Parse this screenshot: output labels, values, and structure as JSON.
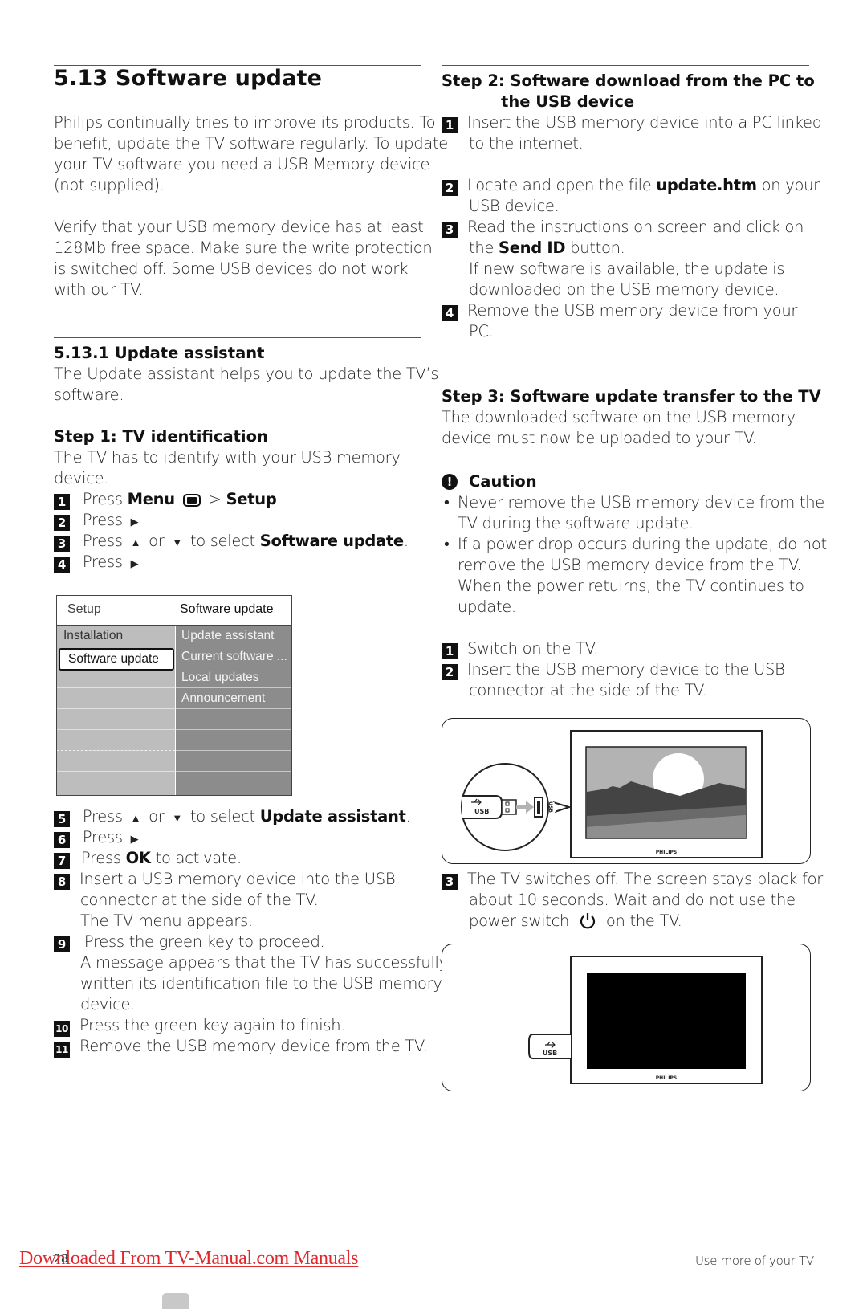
{
  "section": {
    "title": "5.13  Software update",
    "intro": [
      "Philips continually tries to improve its products. To",
      "benefit, update the TV software regularly. To update",
      "your TV software you need a USB Memory device",
      "(not supplied)."
    ],
    "verify": [
      "Verify that your USB memory device has at least",
      "128Mb free space. Make sure the write protection",
      "is switched off. Some USB devices do not work",
      "with our TV."
    ]
  },
  "subsection": {
    "title": "5.13.1  Update assistant",
    "intro": [
      "The Update assistant helps you to update the TV’s",
      "software."
    ]
  },
  "step1": {
    "title": "Step 1: TV identification",
    "intro": [
      "The TV has to identify with your USB memory",
      "device."
    ],
    "items": [
      {
        "num": "1",
        "pre": "Press ",
        "b1": "Menu",
        "mid": " > ",
        "b2": "Setup",
        "post": "."
      },
      {
        "num": "2",
        "pre": "Press ",
        "post": "."
      },
      {
        "num": "3",
        "pre": "Press ",
        "or": " or ",
        "mid": " to select ",
        "b1": "Software update",
        "post": "."
      },
      {
        "num": "4",
        "pre": "Press ",
        "post": "."
      },
      {
        "num": "5",
        "pre": "Press ",
        "or": " or ",
        "mid": " to select ",
        "b1": "Update assistant",
        "post": "."
      },
      {
        "num": "6",
        "pre": "Press ",
        "post": "."
      },
      {
        "num": "7",
        "pre": "Press ",
        "b1": "OK",
        "post": " to activate."
      },
      {
        "num": "8",
        "lines": [
          "Insert a USB memory device into the USB",
          "connector at the side of the TV.",
          "The TV menu appears."
        ]
      },
      {
        "num": "9",
        "lines": [
          " Press the green key to proceed.",
          "A message appears that the TV has successfully",
          "written its identification file to the USB memory",
          "device."
        ]
      },
      {
        "num": "10",
        "lines": [
          "Press the green key again to finish."
        ]
      },
      {
        "num": "11",
        "lines": [
          "Remove the USB memory device from the TV."
        ]
      }
    ],
    "glyphs": {
      "right": "▶",
      "up": "▲",
      "down": "▼"
    }
  },
  "tv_menu": {
    "header_left": "Setup",
    "header_right": "Software update",
    "left_items": [
      "Installation",
      "Software update"
    ],
    "selected": "Software update",
    "right_items": [
      "Update assistant",
      "Current software ...",
      "Local updates",
      "Announcement"
    ]
  },
  "step2": {
    "title_line1": "Step 2: Software download from the PC to",
    "title_line2": "the USB device",
    "items": [
      {
        "num": "1",
        "lines": [
          "Insert the USB memory device into a PC linked",
          "to the internet."
        ]
      },
      {
        "num": "2",
        "pre": "Locate and open the file ",
        "b1": "update.htm",
        "post": " on your",
        "line2": "USB device."
      },
      {
        "num": "3",
        "line1": "Read the instructions on screen and click on",
        "pre": "the ",
        "b1": "Send ID",
        "post": " button.",
        "line3": "If new software is available, the update is",
        "line4": "downloaded on the USB memory device."
      },
      {
        "num": "4",
        "lines": [
          "Remove the USB memory device from your",
          "PC."
        ]
      }
    ]
  },
  "step3": {
    "title": "Step 3: Software update transfer to the TV",
    "intro": [
      "The downloaded software on the USB memory",
      "device must now be uploaded to your TV."
    ],
    "caution": {
      "title": "Caution",
      "bullets": [
        [
          "Never remove the USB memory device from the",
          "TV during the software update."
        ],
        [
          "If a power drop occurs during the update, do not",
          "remove the USB memory device from the TV.",
          "When the power retuirns, the TV continues to",
          "update."
        ]
      ]
    },
    "items": [
      {
        "num": "1",
        "lines": [
          "Switch on the TV."
        ]
      },
      {
        "num": "2",
        "lines": [
          "Insert the USB memory device to the USB",
          "connector at the side of the TV."
        ]
      },
      {
        "num": "3",
        "line1": "The TV switches off. The screen stays black for",
        "line2": "about 10 seconds. Wait and do not use the",
        "pre": "power switch ",
        "post": " on the TV."
      }
    ]
  },
  "illustration": {
    "usb_label": "USB",
    "port_label": "USB",
    "brand": "PHILIPS"
  },
  "footer": {
    "link": "Downloaded From TV-Manual.com Manuals",
    "page": "28",
    "right": "Use more of your TV"
  }
}
